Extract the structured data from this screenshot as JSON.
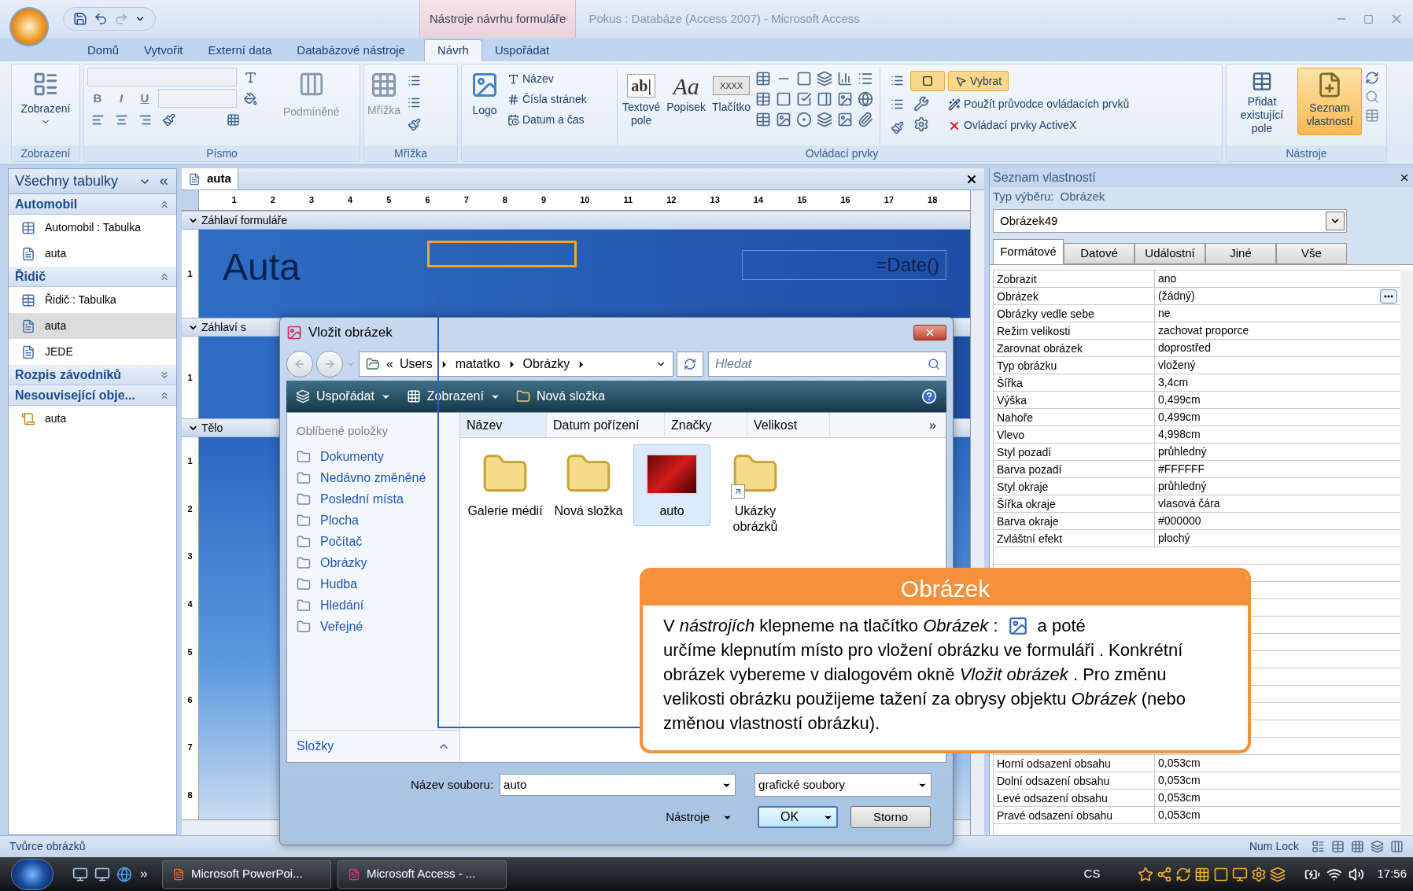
{
  "window": {
    "title": "Pokus : Databáze (Access 2007) - Microsoft Access",
    "context_group": "Nástroje návrhu formuláře"
  },
  "ribbon_tabs": [
    {
      "label": "Domů",
      "selected": false
    },
    {
      "label": "Vytvořit",
      "selected": false
    },
    {
      "label": "Externí data",
      "selected": false
    },
    {
      "label": "Databázové nástroje",
      "selected": false
    },
    {
      "label": "Návrh",
      "selected": true
    },
    {
      "label": "Uspořádat",
      "selected": false
    }
  ],
  "ribbon": {
    "view": {
      "button": "Zobrazení",
      "group": "Zobrazení"
    },
    "font": {
      "group": "Písmo",
      "styles": [
        "B",
        "I",
        "U"
      ],
      "conditional": "Podmíněné"
    },
    "grid": {
      "button": "Mřížka",
      "group": "Mřížka"
    },
    "header_footer": {
      "logo": "Logo",
      "items": [
        "Název",
        "Čísla stránek",
        "Datum a čas"
      ]
    },
    "controls": {
      "group": "Ovládací prvky",
      "big": [
        {
          "label": "Textové pole",
          "glyph": "ab|"
        },
        {
          "label": "Popisek",
          "glyph": "Aa"
        },
        {
          "label": "Tlačítko",
          "glyph": "XXXX"
        }
      ],
      "select": "Vybrat",
      "wizard": "Použít průvodce ovládacích prvků",
      "activex": "Ovládací prvky ActiveX"
    },
    "tools": {
      "group": "Nástroje",
      "buttons": [
        {
          "label": "Přidat existující pole",
          "selected": false
        },
        {
          "label": "Seznam vlastností",
          "selected": true
        }
      ]
    }
  },
  "nav": {
    "title": "Všechny tabulky",
    "groups": [
      {
        "label": "Automobil",
        "expanded": true,
        "items": [
          {
            "label": "Automobil : Tabulka",
            "kind": "table",
            "selected": false
          },
          {
            "label": "auta",
            "kind": "form",
            "selected": false
          }
        ]
      },
      {
        "label": "Řidič",
        "expanded": true,
        "items": [
          {
            "label": "Řidič : Tabulka",
            "kind": "table",
            "selected": false
          },
          {
            "label": "auta",
            "kind": "form",
            "selected": true
          },
          {
            "label": "JEDE",
            "kind": "form",
            "selected": false
          }
        ]
      },
      {
        "label": "Rozpis závodníků",
        "expanded": false
      },
      {
        "label": "Nesouvisející obje...",
        "expanded": true,
        "items": [
          {
            "label": "auta",
            "kind": "macro",
            "selected": false
          }
        ]
      }
    ]
  },
  "designer": {
    "tab": "auta",
    "ruler": [
      "1",
      "2",
      "3",
      "4",
      "5",
      "6",
      "7",
      "8",
      "9",
      "10",
      "11",
      "12",
      "13",
      "14",
      "15",
      "16",
      "17",
      "18"
    ],
    "form_header": {
      "bar": "Záhlaví formuláře",
      "ruler": [
        "1"
      ],
      "title_label": "Auta",
      "date_box": "=Date()"
    },
    "page_header": {
      "bar": "Záhlaví s",
      "ruler": [
        "1"
      ]
    },
    "detail": {
      "bar": "Tělo",
      "ruler": [
        "1",
        "2",
        "3",
        "4",
        "5",
        "6",
        "7",
        "8"
      ]
    }
  },
  "properties": {
    "title": "Seznam vlastností",
    "selection_label": "Typ výběru:",
    "selection_type": "Obrázek",
    "object": "Obrázek49",
    "tabs": [
      {
        "label": "Formátové",
        "selected": true
      },
      {
        "label": "Datové",
        "selected": false
      },
      {
        "label": "Událostní",
        "selected": false
      },
      {
        "label": "Jiné",
        "selected": false
      },
      {
        "label": "Vše",
        "selected": false
      }
    ],
    "rows": [
      {
        "name": "Zobrazit",
        "value": "ano"
      },
      {
        "name": "Obrázek",
        "value": "(žádný)",
        "builder": true
      },
      {
        "name": "Obrázky vedle sebe",
        "value": "ne"
      },
      {
        "name": "Režim velikosti",
        "value": "zachovat proporce"
      },
      {
        "name": "Zarovnat obrázek",
        "value": "doprostřed"
      },
      {
        "name": "Typ obrázku",
        "value": "vložený"
      },
      {
        "name": "Šířka",
        "value": "3,4cm"
      },
      {
        "name": "Výška",
        "value": "0,499cm"
      },
      {
        "name": "Nahoře",
        "value": "0,499cm"
      },
      {
        "name": "Vlevo",
        "value": "4,998cm"
      },
      {
        "name": "Styl pozadí",
        "value": "průhledný"
      },
      {
        "name": "Barva pozadí",
        "value": "#FFFFFF"
      },
      {
        "name": "Styl okraje",
        "value": "průhledný"
      },
      {
        "name": "Šířka okraje",
        "value": "vlasová čára"
      },
      {
        "name": "Barva okraje",
        "value": "#000000"
      },
      {
        "name": "Zvláštní efekt",
        "value": "plochý"
      }
    ],
    "rows_below": [
      {
        "name": "Horní odsazení obsahu",
        "value": "0,053cm"
      },
      {
        "name": "Dolní odsazení obsahu",
        "value": "0,053cm"
      },
      {
        "name": "Levé odsazení obsahu",
        "value": "0,053cm"
      },
      {
        "name": "Pravé odsazení obsahu",
        "value": "0,053cm"
      }
    ]
  },
  "dialog": {
    "title": "Vložit obrázek",
    "path_prefix": "«",
    "path": [
      "Users",
      "matatko",
      "Obrázky"
    ],
    "search": {
      "placeholder": "Hledat"
    },
    "toolbar": [
      "Uspořádat",
      "Zobrazení",
      "Nová složka"
    ],
    "favorites_title": "Oblíbené položky",
    "favorites": [
      "Dokumenty",
      "Nedávno změněné",
      "Poslední místa",
      "Plocha",
      "Počítač",
      "Obrázky",
      "Hudba",
      "Hledání",
      "Veřejné"
    ],
    "folders": "Složky",
    "columns": [
      "Název",
      "Datum pořízení",
      "Značky",
      "Velikost"
    ],
    "more": "»",
    "files": [
      {
        "name": "Galerie médií",
        "kind": "folder",
        "selected": false
      },
      {
        "name": "Nová složka",
        "kind": "folder",
        "selected": false
      },
      {
        "name": "auto",
        "kind": "image",
        "selected": true
      },
      {
        "name": "Ukázky obrázků",
        "kind": "shortcut",
        "selected": false
      }
    ],
    "filename_label": "Název souboru:",
    "filename": "auto",
    "filter": "grafické soubory",
    "tools": "Nástroje",
    "ok": "OK",
    "cancel": "Storno"
  },
  "callout": {
    "title": "Obrázek",
    "text_before": "V *nástrojích*  klepneme na tlačítko  *Obrázek* :",
    "text_after": "a poté",
    "text_rest": "určíme klepnutím místo pro vložení obrázku  ve formuláři . Konkrétní  obrázek  vybereme v dialogovém okně *Vložit obrázek* . Pro změnu velikosti obrázku použijeme tažení za obrysy objektu *Obrázek*  (nebo změnou vlastností obrázku)."
  },
  "status_bar": {
    "left": "Tvůrce obrázků",
    "num_lock": "Num Lock"
  },
  "taskbar": {
    "tasks": [
      "Microsoft PowerPoi...",
      "Microsoft Access - ..."
    ],
    "language": "CS",
    "time": "17:56"
  }
}
